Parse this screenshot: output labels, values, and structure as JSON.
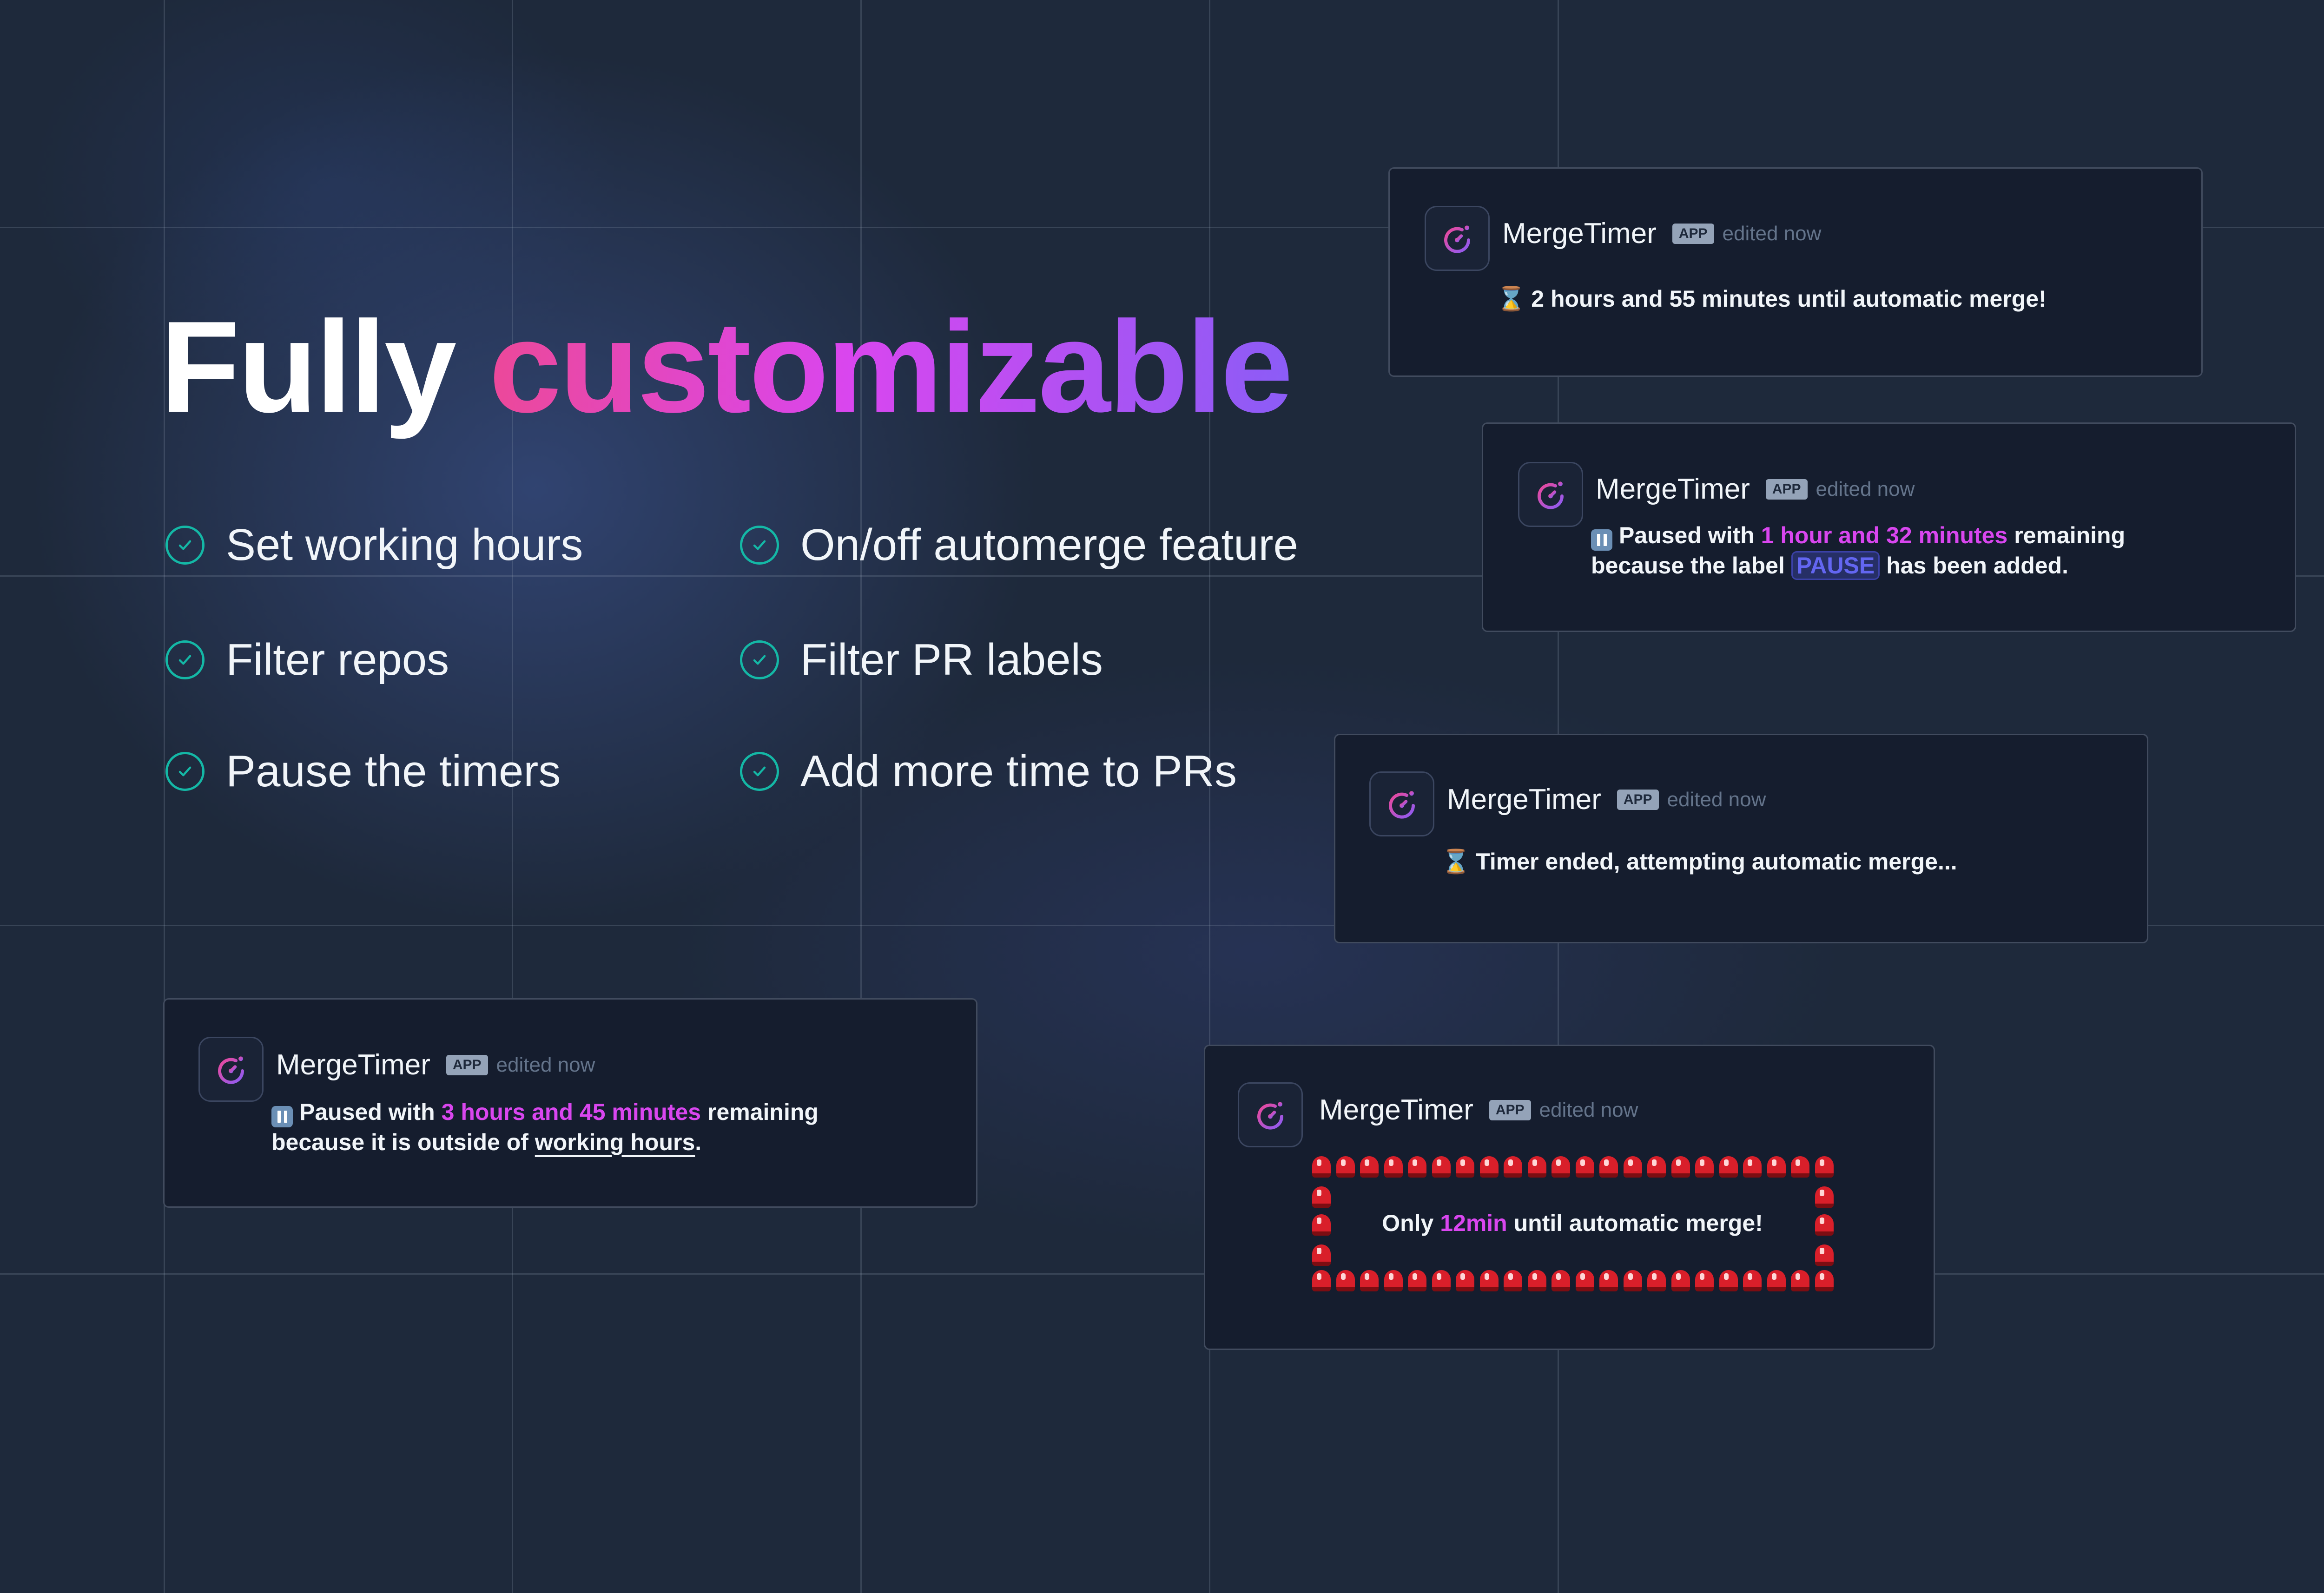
{
  "headline": {
    "lead": "Fully",
    "accent": "customizable"
  },
  "features": [
    {
      "label": "Set working hours"
    },
    {
      "label": "On/off automerge feature"
    },
    {
      "label": "Filter repos"
    },
    {
      "label": "Filter PR labels"
    },
    {
      "label": "Pause the timers"
    },
    {
      "label": "Add more time to PRs"
    }
  ],
  "check_icon": "check-circle-icon",
  "colors": {
    "background": "#1e293b",
    "gradient_start": "#ec4899",
    "gradient_end": "#8b5cf6",
    "highlight": "#d946ef",
    "check": "#14b8a6"
  },
  "bot": {
    "name": "MergeTimer",
    "badge": "APP",
    "edited": "edited now"
  },
  "cards": {
    "timer": {
      "text": "2 hours and 55 minutes until automatic merge!"
    },
    "label_pause": {
      "prefix": "Paused with ",
      "highlight": "1 hour and 32 minutes",
      "suffix": " remaining",
      "line2_prefix": "because the label ",
      "label": "PAUSE",
      "line2_suffix": " has been added."
    },
    "ended": {
      "text": "Timer ended, attempting automatic merge..."
    },
    "hours_pause": {
      "prefix": "Paused with ",
      "highlight": "3 hours and 45 minutes",
      "suffix": " remaining",
      "line2_prefix": "because it is outside of ",
      "link": "working hours",
      "line2_suffix": "."
    },
    "siren": {
      "prefix": "Only ",
      "highlight": "12min",
      "suffix": " until automatic merge!"
    }
  }
}
